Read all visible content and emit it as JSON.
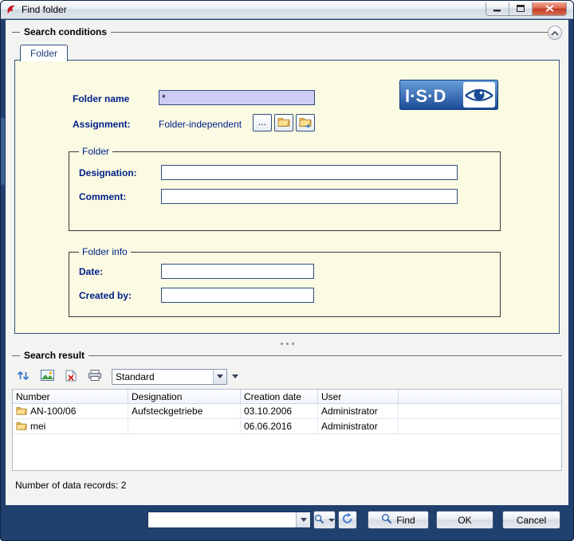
{
  "window": {
    "title": "Find folder"
  },
  "search_conditions": {
    "title": "Search conditions",
    "tab_label": "Folder",
    "folder_name_label": "Folder name",
    "folder_name_value": "*",
    "assignment_label": "Assignment:",
    "assignment_value": "Folder-independent",
    "assignment_browse_label": "…",
    "logo_text": "I·S·D",
    "folder_group": {
      "title": "Folder",
      "designation_label": "Designation:",
      "designation_value": "",
      "comment_label": "Comment:",
      "comment_value": ""
    },
    "folder_info_group": {
      "title": "Folder info",
      "date_label": "Date:",
      "date_value": "",
      "created_by_label": "Created by:",
      "created_by_value": ""
    }
  },
  "search_result": {
    "title": "Search result",
    "view_value": "Standard",
    "table": {
      "columns": [
        "Number",
        "Designation",
        "Creation date",
        "User",
        ""
      ],
      "rows": [
        {
          "number": "AN-100/06",
          "designation": "Aufsteckgetriebe",
          "creation_date": "03.10.2006",
          "user": "Administrator"
        },
        {
          "number": "mei",
          "designation": "",
          "creation_date": "06.06.2016",
          "user": "Administrator"
        }
      ]
    },
    "count_text": "Number of data records: 2"
  },
  "footer": {
    "quick_search_value": "",
    "find_label": "Find",
    "ok_label": "OK",
    "cancel_label": "Cancel"
  },
  "colors": {
    "frame_navy": "#20406e",
    "panel_yellow": "#fbfae2",
    "label_navy": "#002089",
    "accent_blue": "#2f74d0",
    "close_red": "#c03a22"
  }
}
